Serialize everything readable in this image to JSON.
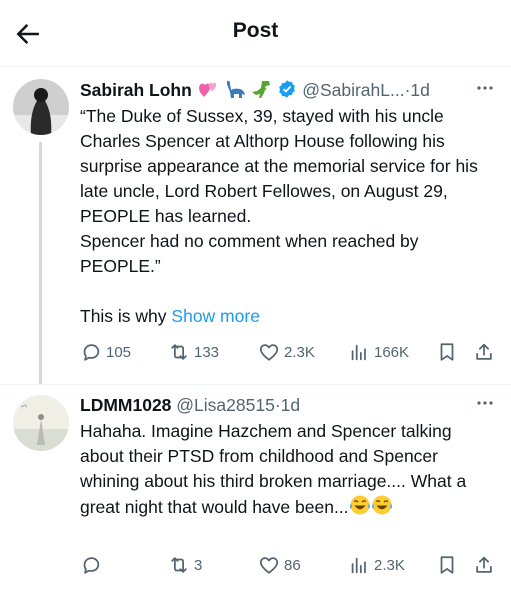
{
  "header": {
    "title": "Post"
  },
  "posts": [
    {
      "name": "Sabirah Lohn",
      "handle": "@SabirahL...",
      "sep": "·",
      "time": "1d",
      "body": [
        "“The Duke of Sussex, 39, stayed with his uncle Charles Spencer at Althorp House following his surprise appearance at the memorial service for his late uncle, Lord Robert Fellowes, on August 29, PEOPLE has learned.",
        "Spencer had no comment when reached by PEOPLE.”"
      ],
      "teaser": "This is why",
      "show_more": "Show more",
      "stats": {
        "replies": "105",
        "reposts": "133",
        "likes": "2.3K",
        "views": "166K"
      }
    },
    {
      "name": "LDMM1028",
      "handle": "@Lisa28515",
      "sep": "·",
      "time": "1d",
      "body_text": "Hahaha. Imagine Hazchem and Spencer talking about their PTSD from childhood and Spencer whining about his third broken marriage.... What a great night that would have been...",
      "stats": {
        "replies": "",
        "reposts": "3",
        "likes": "86",
        "views": "2.3K"
      }
    }
  ],
  "colors": {
    "accent": "#1d9bf0",
    "muted": "#536471",
    "verified": "#1d9bf0"
  }
}
